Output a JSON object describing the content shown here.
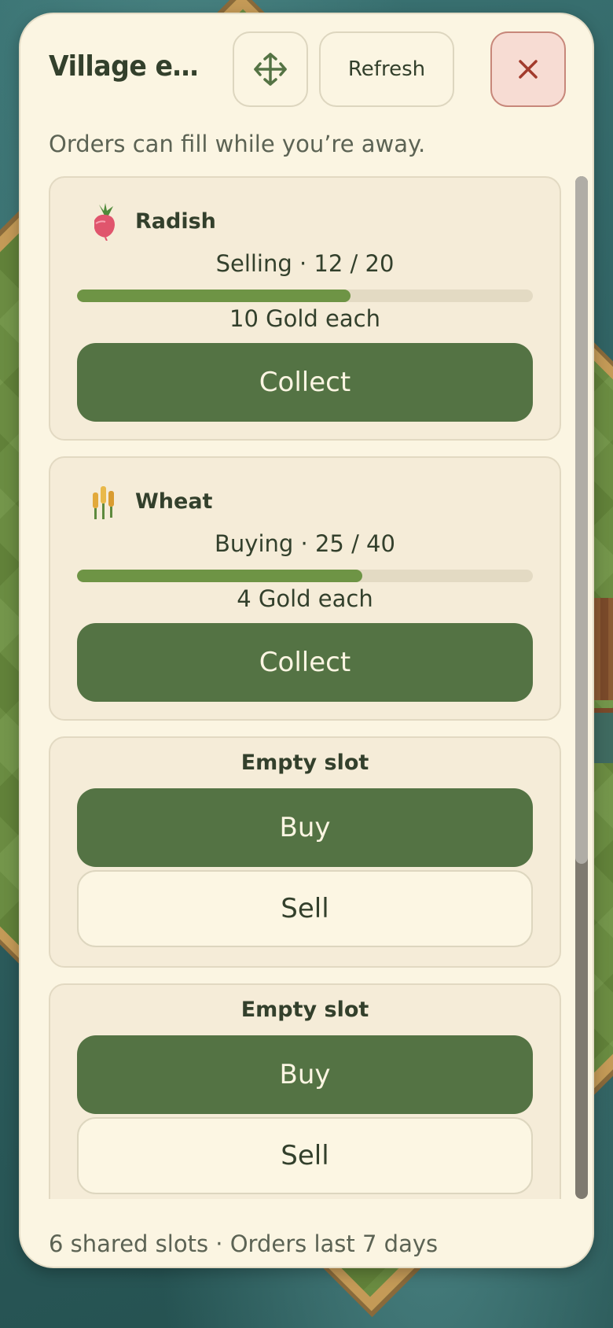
{
  "panel": {
    "title": "Village ex...",
    "refresh_label": "Refresh",
    "subtitle": "Orders can fill while you’re away.",
    "footer": "6 shared slots · Orders last 7 days"
  },
  "orders": [
    {
      "item": "Radish",
      "icon": "radish-icon",
      "status": "Selling · 12 / 20",
      "progress_fraction": 0.6,
      "price": "10 Gold each",
      "action": "Collect"
    },
    {
      "item": "Wheat",
      "icon": "wheat-icon",
      "status": "Buying · 25 / 40",
      "progress_fraction": 0.625,
      "price": "4 Gold each",
      "action": "Collect"
    }
  ],
  "empty_slots": [
    {
      "title": "Empty slot",
      "buy_label": "Buy",
      "sell_label": "Sell"
    },
    {
      "title": "Empty slot",
      "buy_label": "Buy",
      "sell_label": "Sell"
    }
  ],
  "colors": {
    "panel_bg": "#fbf5e2",
    "card_bg": "#f5ecd8",
    "primary_green": "#547344",
    "progress_green": "#6e9445",
    "close_bg": "#f7dcd3",
    "close_icon": "#a23b2c",
    "text_dark": "#33402c"
  },
  "icons": {
    "move": "move-arrows-icon",
    "close": "close-icon"
  }
}
